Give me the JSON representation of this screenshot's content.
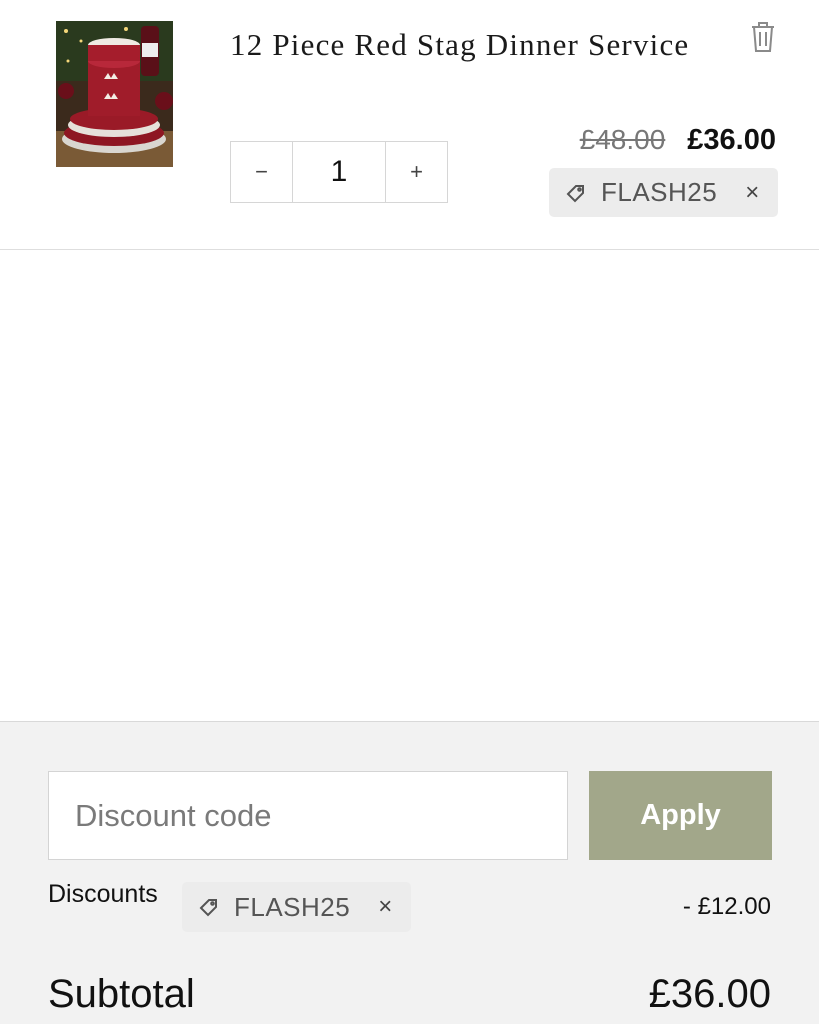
{
  "cart_item": {
    "image_icon": "product-thumbnail",
    "title": "12 Piece Red Stag Dinner Service",
    "quantity": "1",
    "decrement_label": "−",
    "increment_label": "+",
    "original_price": "£48.00",
    "sale_price": "£36.00",
    "discount_code": "FLASH25",
    "remove_code_label": "×",
    "remove_icon": "trash-icon"
  },
  "discount_form": {
    "placeholder": "Discount code",
    "value": "",
    "apply_label": "Apply"
  },
  "discounts": {
    "label": "Discounts",
    "code": "FLASH25",
    "remove_label": "×",
    "amount": "- £12.00"
  },
  "subtotal": {
    "label": "Subtotal",
    "value": "£36.00"
  },
  "colors": {
    "apply_button": "#a2a78a",
    "chip_background": "#ececec",
    "summary_background": "#f2f2f2"
  }
}
